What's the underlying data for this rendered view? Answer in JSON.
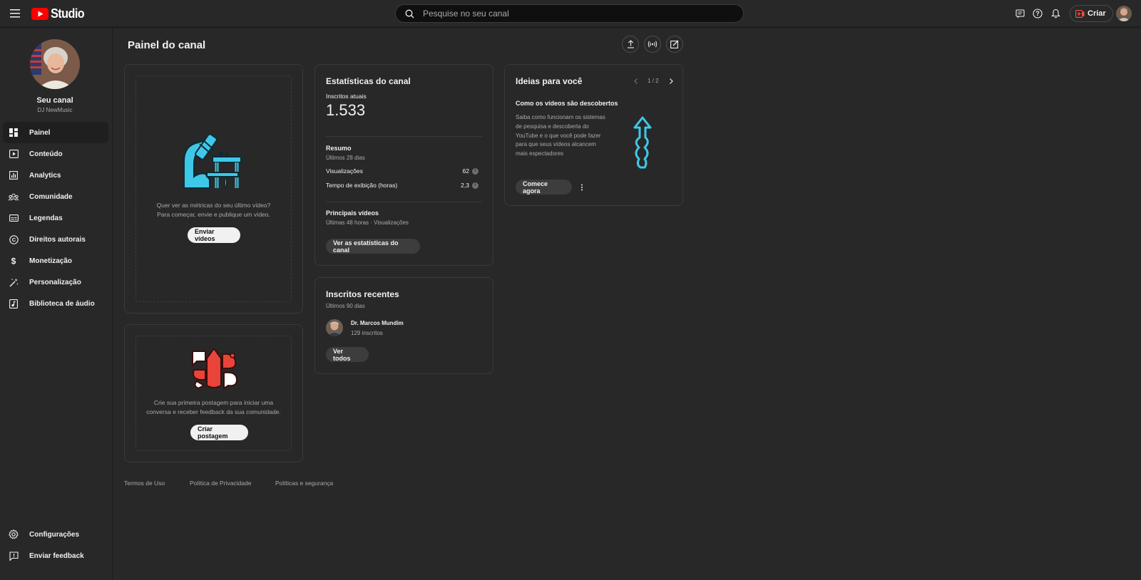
{
  "app": {
    "logo_text": "Studio",
    "search_placeholder": "Pesquise no seu canal",
    "create_label": "Criar"
  },
  "channel": {
    "title": "Seu canal",
    "name": "DJ NewMusic"
  },
  "sidebar": {
    "items": [
      {
        "label": "Painel",
        "icon": "dashboard-icon",
        "active": true
      },
      {
        "label": "Conteúdo",
        "icon": "content-icon"
      },
      {
        "label": "Analytics",
        "icon": "analytics-icon"
      },
      {
        "label": "Comunidade",
        "icon": "community-icon"
      },
      {
        "label": "Legendas",
        "icon": "subtitles-icon"
      },
      {
        "label": "Direitos autorais",
        "icon": "copyright-icon"
      },
      {
        "label": "Monetização",
        "icon": "dollar-icon"
      },
      {
        "label": "Personalização",
        "icon": "magic-wand-icon"
      },
      {
        "label": "Biblioteca de áudio",
        "icon": "audio-library-icon"
      }
    ],
    "bottom": [
      {
        "label": "Configurações",
        "icon": "gear-icon"
      },
      {
        "label": "Enviar feedback",
        "icon": "feedback-icon"
      }
    ]
  },
  "main": {
    "title": "Painel do canal",
    "upload_card": {
      "text_line1": "Quer ver as métricas do seu último vídeo?",
      "text_line2": "Para começar, envie e publique um vídeo.",
      "button": "Enviar vídeos"
    },
    "post_card": {
      "text_line1": "Crie sua primeira postagem para iniciar uma",
      "text_line2": "conversa e receber feedback da sua comunidade.",
      "button": "Criar postagem"
    },
    "stats_card": {
      "title": "Estatísticas do canal",
      "subs_label": "Inscritos atuais",
      "subs_value": "1.533",
      "summary_title": "Resumo",
      "summary_period": "Últimos 28 dias",
      "rows": [
        {
          "label": "Visualizações",
          "value": "62"
        },
        {
          "label": "Tempo de exibição (horas)",
          "value": "2,3"
        }
      ],
      "top_title": "Principais vídeos",
      "top_sub": "Últimas 48 horas · Visualizações",
      "button": "Ver as estatísticas do canal"
    },
    "subs_card": {
      "title": "Inscritos recentes",
      "period": "Últimos 90 dias",
      "subscriber_name": "Dr. Marcos Mundim",
      "subscriber_count": "129 inscritos",
      "button": "Ver todos"
    },
    "ideas_card": {
      "title": "Ideias para você",
      "pager": "1 / 2",
      "idea_title": "Como os vídeos são descobertos",
      "idea_text": [
        "Saiba como funcionam os sistemas",
        "de pesquisa e descoberta do",
        "YouTube e o que você pode fazer",
        "para que seus vídeos alcancem",
        "mais espectadores"
      ],
      "button": "Comece agora"
    }
  },
  "footer": {
    "links": [
      "Termos de Uso",
      "Política de Privacidade",
      "Políticas e segurança"
    ]
  },
  "colors": {
    "background": "#282828",
    "brand_red": "#ff0000",
    "illustration_cyan": "#3ec8e8",
    "illustration_red": "#e8443a"
  }
}
